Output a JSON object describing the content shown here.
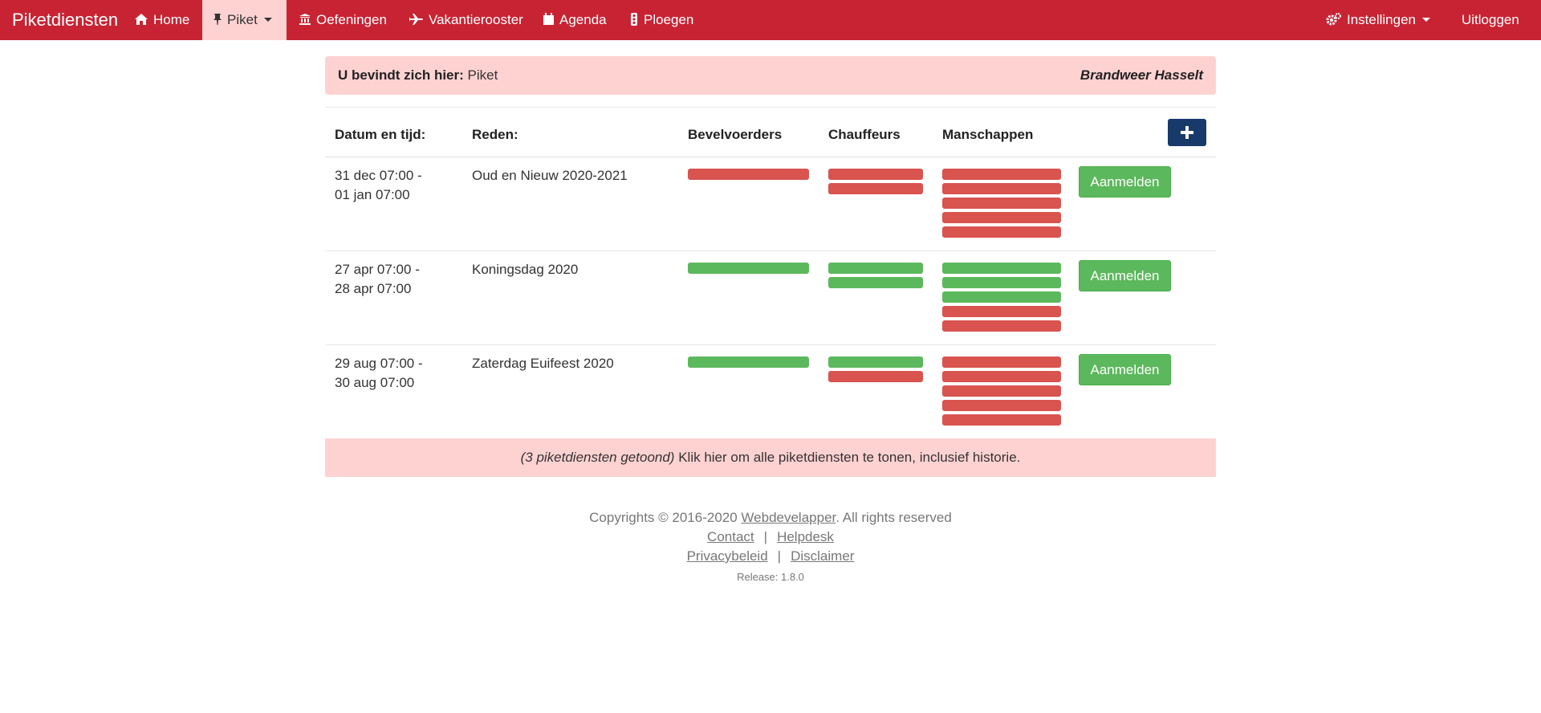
{
  "navbar": {
    "brand": "Piketdiensten",
    "items": [
      {
        "label": "Home",
        "icon": "home-icon"
      },
      {
        "label": "Piket",
        "icon": "pin-icon",
        "active": true
      },
      {
        "label": "Oefeningen",
        "icon": "bank-icon"
      },
      {
        "label": "Vakantierooster",
        "icon": "plane-icon"
      },
      {
        "label": "Agenda",
        "icon": "calendar-icon"
      },
      {
        "label": "Ploegen",
        "icon": "traffic-light-icon"
      }
    ],
    "settings": "Instellingen",
    "logout": "Uitloggen"
  },
  "breadcrumb": {
    "prefix": "U bevindt zich hier:",
    "current": "Piket",
    "organisation": "Brandweer Hasselt"
  },
  "table": {
    "headers": [
      "Datum en tijd:",
      "Reden:",
      "Bevelvoerders",
      "Chauffeurs",
      "Manschappen"
    ],
    "rows": [
      {
        "date_line1": "31 dec 07:00 -",
        "date_line2": "01 jan 07:00",
        "reason": "Oud en Nieuw 2020-2021",
        "bevelvoerders": [
          "red"
        ],
        "chauffeurs": [
          "red",
          "red"
        ],
        "manschappen": [
          "red",
          "red",
          "red",
          "red",
          "red"
        ],
        "button": "Aanmelden"
      },
      {
        "date_line1": "27 apr 07:00 -",
        "date_line2": "28 apr 07:00",
        "reason": "Koningsdag 2020",
        "bevelvoerders": [
          "green"
        ],
        "chauffeurs": [
          "green",
          "green"
        ],
        "manschappen": [
          "green",
          "green",
          "green",
          "red",
          "red"
        ],
        "button": "Aanmelden"
      },
      {
        "date_line1": "29 aug 07:00 -",
        "date_line2": "30 aug 07:00",
        "reason": "Zaterdag Euifeest 2020",
        "bevelvoerders": [
          "green"
        ],
        "chauffeurs": [
          "green",
          "red"
        ],
        "manschappen": [
          "red",
          "red",
          "red",
          "red",
          "red"
        ],
        "button": "Aanmelden"
      }
    ]
  },
  "footer_banner": {
    "count_text": "(3 piketdiensten getoond)",
    "link_text": "Klik hier om alle piketdiensten te tonen, inclusief historie."
  },
  "footer": {
    "copyright_prefix": "Copyrights © 2016-2020",
    "company": "Webdevelapper",
    "copyright_suffix": ". All rights reserved",
    "contact": "Contact",
    "helpdesk": "Helpdesk",
    "privacy": "Privacybeleid",
    "disclaimer": "Disclaimer",
    "separator": "|",
    "release": "Release: 1.8.0"
  },
  "colors": {
    "navbar": "#c82333",
    "highlight": "#ffd2d2",
    "success": "#5cb85c",
    "danger": "#d9534f",
    "primary": "#173a6b"
  }
}
